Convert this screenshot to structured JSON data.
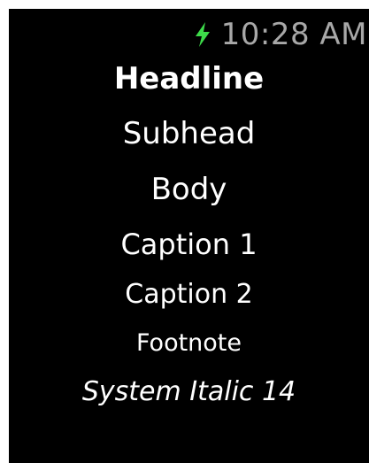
{
  "status_bar": {
    "charging_icon": "bolt-icon",
    "charging_color": "#3ddc4a",
    "time": "10:28 AM"
  },
  "text_styles": [
    "Headline",
    "Subhead",
    "Body",
    "Caption 1",
    "Caption 2",
    "Footnote",
    "System Italic 14"
  ],
  "colors": {
    "background": "#000000",
    "text": "#ffffff",
    "time": "#a8a8a8"
  }
}
